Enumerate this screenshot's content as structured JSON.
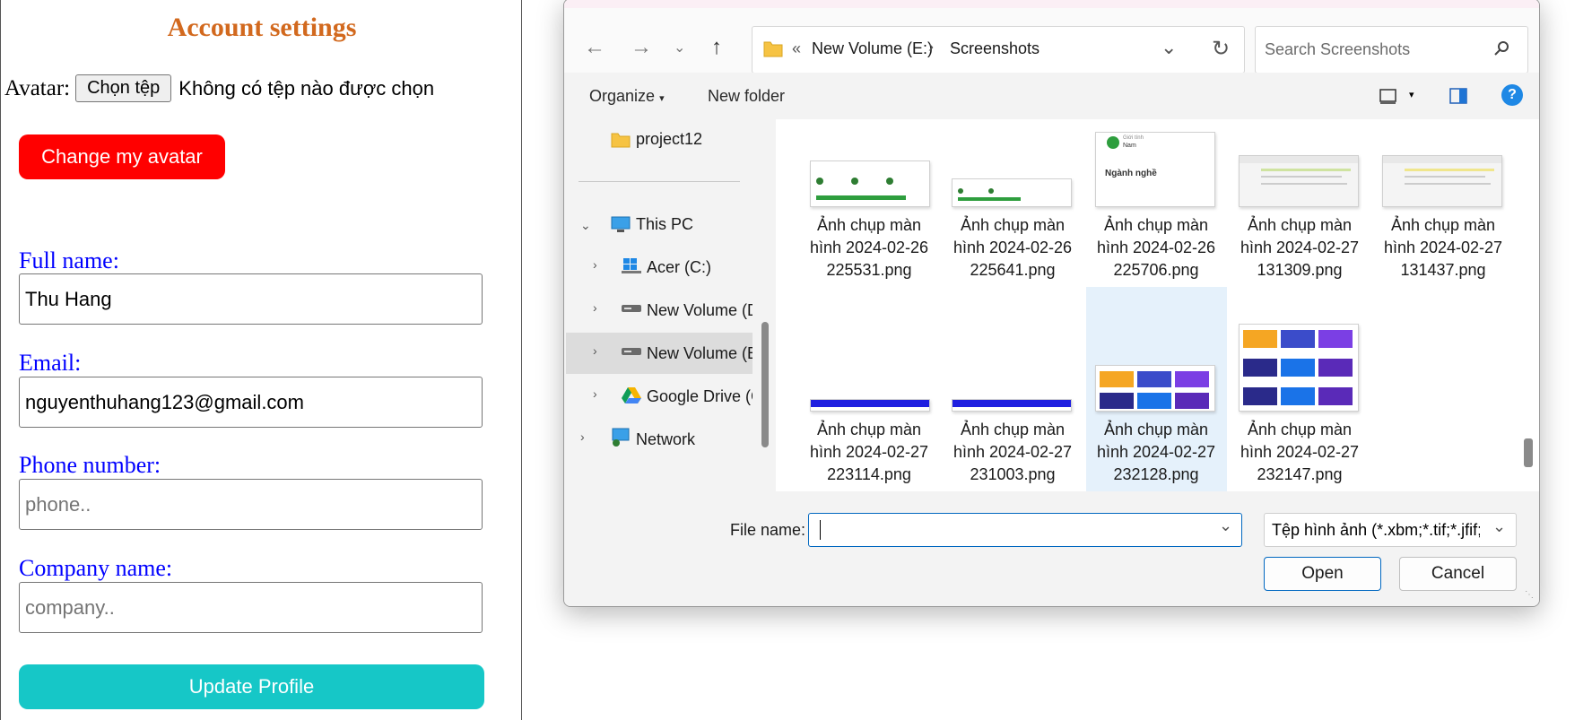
{
  "page": {
    "title": "Account settings",
    "avatar_label": "Avatar:",
    "choose_file_label": "Chọn tệp",
    "no_file_text": "Không có tệp nào được chọn",
    "change_avatar_label": "Change my avatar",
    "fullname_label": "Full name:",
    "fullname_value": "Thu Hang",
    "email_label": "Email:",
    "email_value": "nguyenthuhang123@gmail.com",
    "phone_label": "Phone number:",
    "phone_placeholder": "phone..",
    "company_label": "Company name:",
    "company_placeholder": "company..",
    "update_label": "Update Profile"
  },
  "dialog": {
    "breadcrumb_sep": "«",
    "breadcrumb": [
      "New Volume (E:)",
      "Screenshots"
    ],
    "search_placeholder": "Search Screenshots",
    "organize_label": "Organize",
    "new_folder_label": "New folder",
    "nav": {
      "folder": "project12",
      "this_pc": "This PC",
      "drives": [
        "Acer (C:)",
        "New Volume (D:)",
        "New Volume (E:)",
        "Google Drive (G:)"
      ],
      "network": "Network"
    },
    "files": [
      {
        "l1": "Ảnh chụp màn",
        "l2": "hình 2024-02-26",
        "l3": "225531.png"
      },
      {
        "l1": "Ảnh chụp màn",
        "l2": "hình 2024-02-26",
        "l3": "225641.png"
      },
      {
        "l1": "Ảnh chụp màn",
        "l2": "hình 2024-02-26",
        "l3": "225706.png"
      },
      {
        "l1": "Ảnh chụp màn",
        "l2": "hình 2024-02-27",
        "l3": "131309.png"
      },
      {
        "l1": "Ảnh chụp màn",
        "l2": "hình 2024-02-27",
        "l3": "131437.png"
      },
      {
        "l1": "Ảnh chụp màn",
        "l2": "hình 2024-02-27",
        "l3": "223114.png"
      },
      {
        "l1": "Ảnh chụp màn",
        "l2": "hình 2024-02-27",
        "l3": "231003.png"
      },
      {
        "l1": "Ảnh chụp màn",
        "l2": "hình 2024-02-27",
        "l3": "232128.png"
      },
      {
        "l1": "Ảnh chụp màn",
        "l2": "hình 2024-02-27",
        "l3": "232147.png"
      }
    ],
    "thumb_texts": {
      "t3_a": "Giới tính",
      "t3_b": "Nam",
      "t3_c": "Ngành nghề"
    },
    "filename_label": "File name:",
    "filename_value": "",
    "filter_value": "Tệp hình ảnh (*.xbm;*.tif;*.jfif;*.ico",
    "open_label": "Open",
    "cancel_label": "Cancel",
    "colors": {
      "accent": "#0067c0",
      "selected": "#e5f1fb"
    }
  }
}
